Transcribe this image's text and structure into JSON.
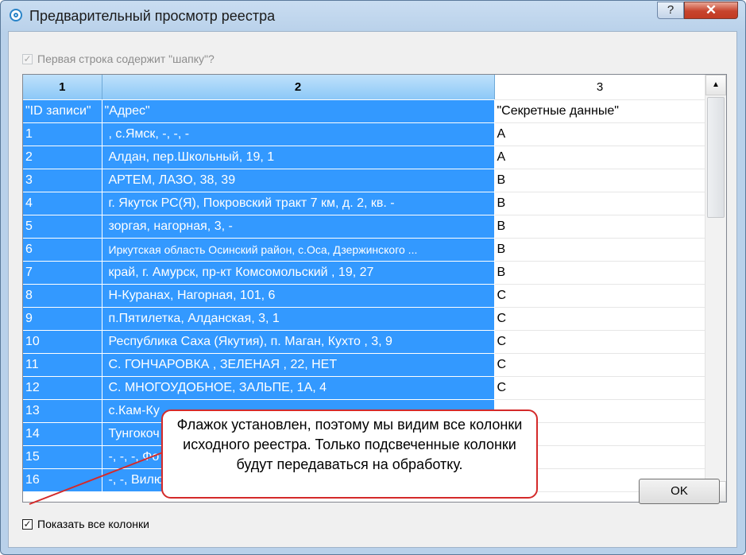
{
  "window": {
    "title": "Предварительный просмотр реестра",
    "help": "?",
    "close": "✕"
  },
  "header_checkbox": {
    "label": "Первая строка содержит \"шапку\"?",
    "checked": true,
    "enabled": false
  },
  "grid": {
    "columns": [
      "1",
      "2",
      "3"
    ],
    "rows": [
      [
        "\"ID записи\"",
        "\"Адрес\"",
        "\"Секретные данные\""
      ],
      [
        "1",
        ", с.Ямск, -, -, -",
        "A"
      ],
      [
        "2",
        "Алдан, пер.Школьный, 19, 1",
        "A"
      ],
      [
        "3",
        "АРТЕМ, ЛАЗО, 38, 39",
        "B"
      ],
      [
        "4",
        "г. Якутск РС(Я), Покровский тракт 7 км, д. 2, кв. -",
        "B"
      ],
      [
        "5",
        "зоргая, нагорная, 3,  -",
        "B"
      ],
      [
        "6",
        "Иркутская область Осинский район, с.Оса, Дзержинского ...",
        "B"
      ],
      [
        "7",
        "край, г. Амурск, пр-кт Комсомольский , 19, 27",
        "B"
      ],
      [
        "8",
        "Н-Куранах, Нагорная, 101, 6",
        "C"
      ],
      [
        "9",
        "п.Пятилетка, Алданская, 3, 1",
        "C"
      ],
      [
        "10",
        "Республика Саха (Якутия), п. Маган, Кухто , 3, 9",
        "C"
      ],
      [
        "11",
        "С. ГОНЧАРОВКА , ЗЕЛЕНАЯ , 22, НЕТ",
        "C"
      ],
      [
        "12",
        "С. МНОГОУДОБНОЕ, ЗАЛЬПЕ, 1А, 4",
        "C"
      ],
      [
        "13",
        "с.Кам-Ку",
        ""
      ],
      [
        "14",
        "Тунгокоч",
        ""
      ],
      [
        "15",
        "-, -, -, Фо",
        ""
      ],
      [
        "16",
        "-, -, Вилю",
        ""
      ]
    ]
  },
  "show_all_checkbox": {
    "label": "Показать все колонки",
    "checked": true
  },
  "ok_button": "OK",
  "callout": "Флажок установлен, поэтому мы видим все колонки исходного реестра. Только подсвеченные колонки будут передаваться на обработку.",
  "colors": {
    "selected": "#3399ff",
    "callout_border": "#d42a2a"
  }
}
